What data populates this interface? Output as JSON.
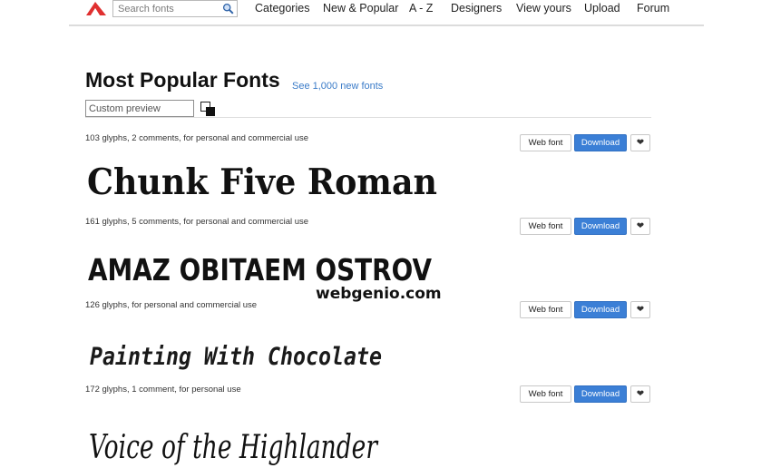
{
  "header": {
    "search_placeholder": "Search fonts",
    "nav": [
      "Categories",
      "New & Popular",
      "A - Z",
      "Designers",
      "View yours",
      "Upload",
      "Forum"
    ]
  },
  "main": {
    "title": "Most Popular Fonts",
    "new_fonts_link": "See 1,000 new fonts",
    "preview_placeholder": "Custom preview"
  },
  "buttons": {
    "web_font": "Web font",
    "download": "Download"
  },
  "fonts": [
    {
      "meta": "103 glyphs, 2 comments, for personal and commercial use",
      "sample": "Chunk Five Roman"
    },
    {
      "meta": "161 glyphs, 5 comments, for personal and commercial use",
      "sample": "AMAZ OBITAEM OSTROV",
      "sub": "webgenio.com"
    },
    {
      "meta": "126 glyphs, for personal and commercial use",
      "sample": "Painting With Chocolate"
    },
    {
      "meta": "172 glyphs, 1 comment, for personal use",
      "sample": "Voice of the Highlander"
    }
  ],
  "colors": {
    "accent": "#3b7fd6",
    "link": "#3a7bc8",
    "logo": "#e03030"
  },
  "icons": {
    "logo": "logo-icon",
    "search": "search-icon",
    "favorite": "heart-icon",
    "color_toggle": "color-swap-icon"
  }
}
